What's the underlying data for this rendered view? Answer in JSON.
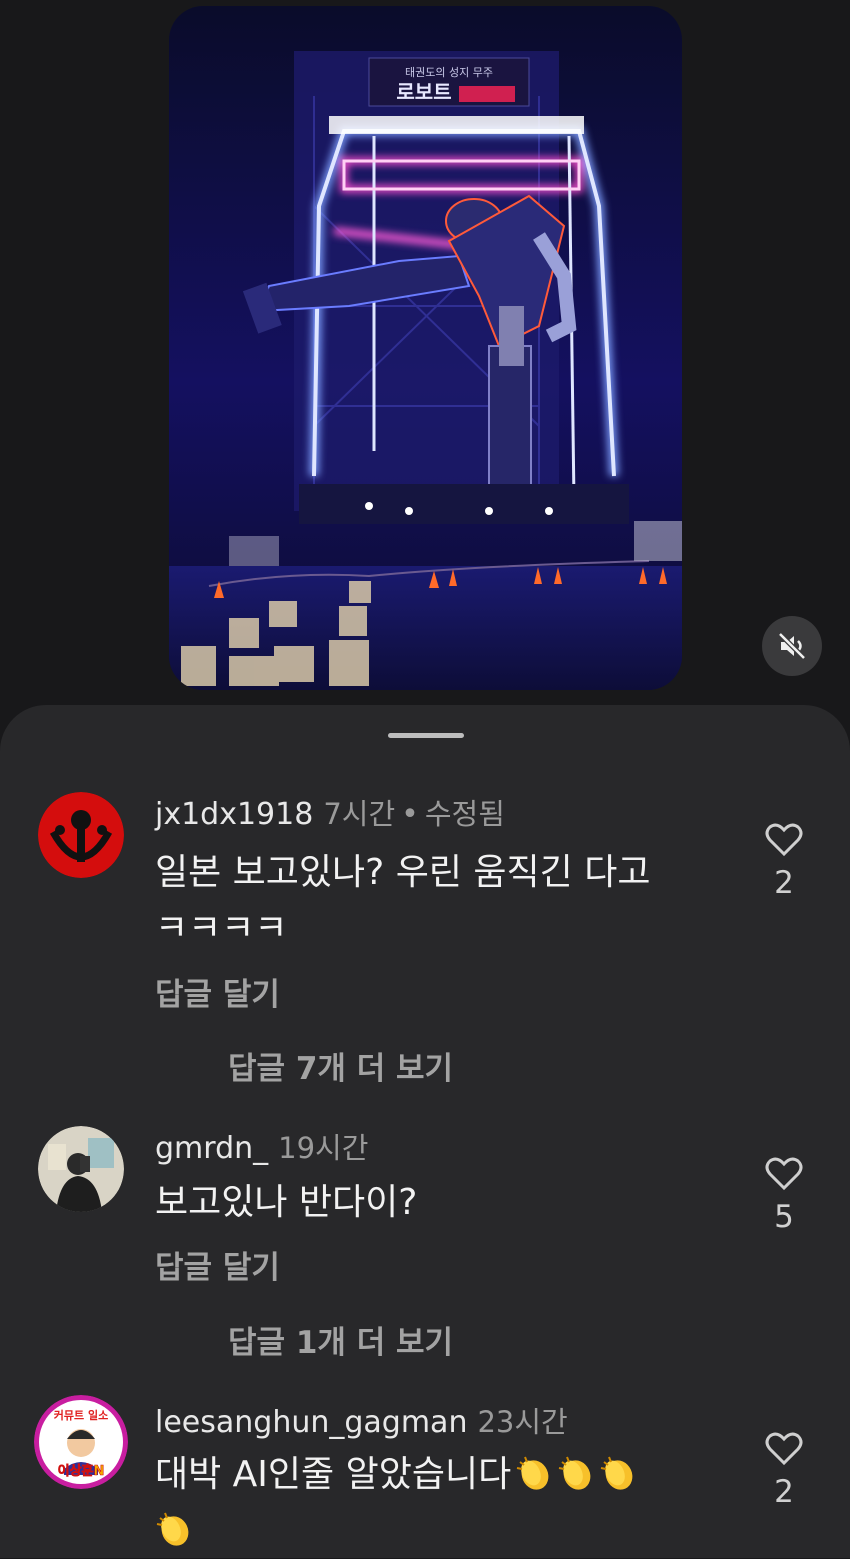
{
  "video": {
    "sign_line1": "태권도의 성지 무주",
    "sign_line2": "로보트",
    "mute_icon": "speaker-muted-icon"
  },
  "comments": [
    {
      "username": "jx1dx1918",
      "time": "7시간",
      "edited": "수정됨",
      "text_line1": "일본 보고있나? 우린 움직긴 다고",
      "text_line2": "ㅋㅋㅋㅋ",
      "reply": "답글 달기",
      "more_replies": "답글 7개 더 보기",
      "likes": "2"
    },
    {
      "username": "gmrdn_",
      "time": "19시간",
      "text_line1": "보고있나 반다이?",
      "reply": "답글 달기",
      "more_replies": "답글 1개 더 보기",
      "likes": "5"
    },
    {
      "username": "leesanghun_gagman",
      "time": "23시간",
      "text_line1": "대박 AI인줄 알았습니다",
      "likes": "2",
      "avatar_text_top": "커뮤트 일소",
      "avatar_text_bottom": "이상훈N"
    }
  ],
  "colors": {
    "background": "#18181a",
    "sheet": "#28282a",
    "neon_blue": "#5a7bff",
    "neon_pink": "#ff3fc8"
  }
}
